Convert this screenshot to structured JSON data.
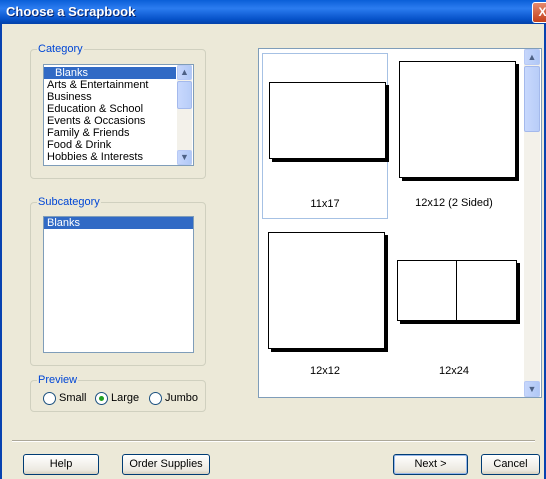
{
  "window": {
    "title": "Choose a Scrapbook",
    "close_glyph": "X"
  },
  "category": {
    "legend": "Category",
    "items": [
      "Blanks",
      "Arts & Entertainment",
      "Business",
      "Education & School",
      "Events & Occasions",
      "Family & Friends",
      "Food & Drink",
      "Hobbies & Interests"
    ],
    "selected": "Blanks"
  },
  "subcategory": {
    "legend": "Subcategory",
    "items": [
      "Blanks"
    ],
    "selected": "Blanks"
  },
  "preview_options": {
    "legend": "Preview",
    "small": "Small",
    "large": "Large",
    "jumbo": "Jumbo",
    "selected": "Large"
  },
  "layouts": [
    {
      "label": "11x17",
      "selected": true
    },
    {
      "label": "12x12 (2 Sided)",
      "selected": false
    },
    {
      "label": "12x12",
      "selected": false
    },
    {
      "label": "12x24",
      "selected": false
    }
  ],
  "buttons": {
    "help": "Help",
    "order_supplies": "Order Supplies",
    "next": "Next >",
    "cancel": "Cancel"
  },
  "icons": {
    "scroll_up": "▲",
    "scroll_down": "▼"
  },
  "colors": {
    "title_bar": "#0a5fd8",
    "selection": "#316ac5",
    "radio_dot": "#21a121",
    "group_legend": "#0046d5"
  }
}
